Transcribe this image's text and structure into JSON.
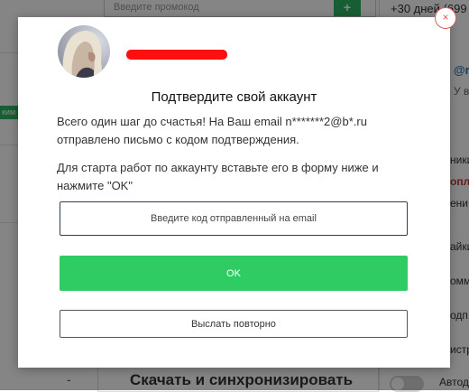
{
  "background": {
    "promo_placeholder": "Введите промокод",
    "promo_button": "+",
    "top_right": "+30 дней (699",
    "green_tab": "ким",
    "right_items": [
      "@r",
      "У в",
      "ники",
      "опл",
      "ени",
      "айки",
      "омм",
      "одп",
      "истр",
      "Автод"
    ],
    "bottom_title": "Скачать и синхронизировать",
    "minus_sign": "-"
  },
  "modal": {
    "title": "Подтвердите свой аккаунт",
    "paragraph_1": "Всего один шаг до счастья! На Ваш email n*******2@b*.ru отправлено письмо с кодом подтверждения.",
    "paragraph_2": "Для старта работ по аккаунту вставьте его в форму ниже и нажмите \"OK\"",
    "code_input": {
      "placeholder": "Введите код отправленный на email",
      "value": ""
    },
    "ok_label": "OK",
    "resend_label": "Выслать повторно",
    "close_label": "×"
  },
  "colors": {
    "accent_green": "#2ecc62",
    "close_red": "#e35a5a",
    "redaction": "#ff1010"
  },
  "icons": {
    "close": "close-icon",
    "toggle": "toggle-switch"
  }
}
